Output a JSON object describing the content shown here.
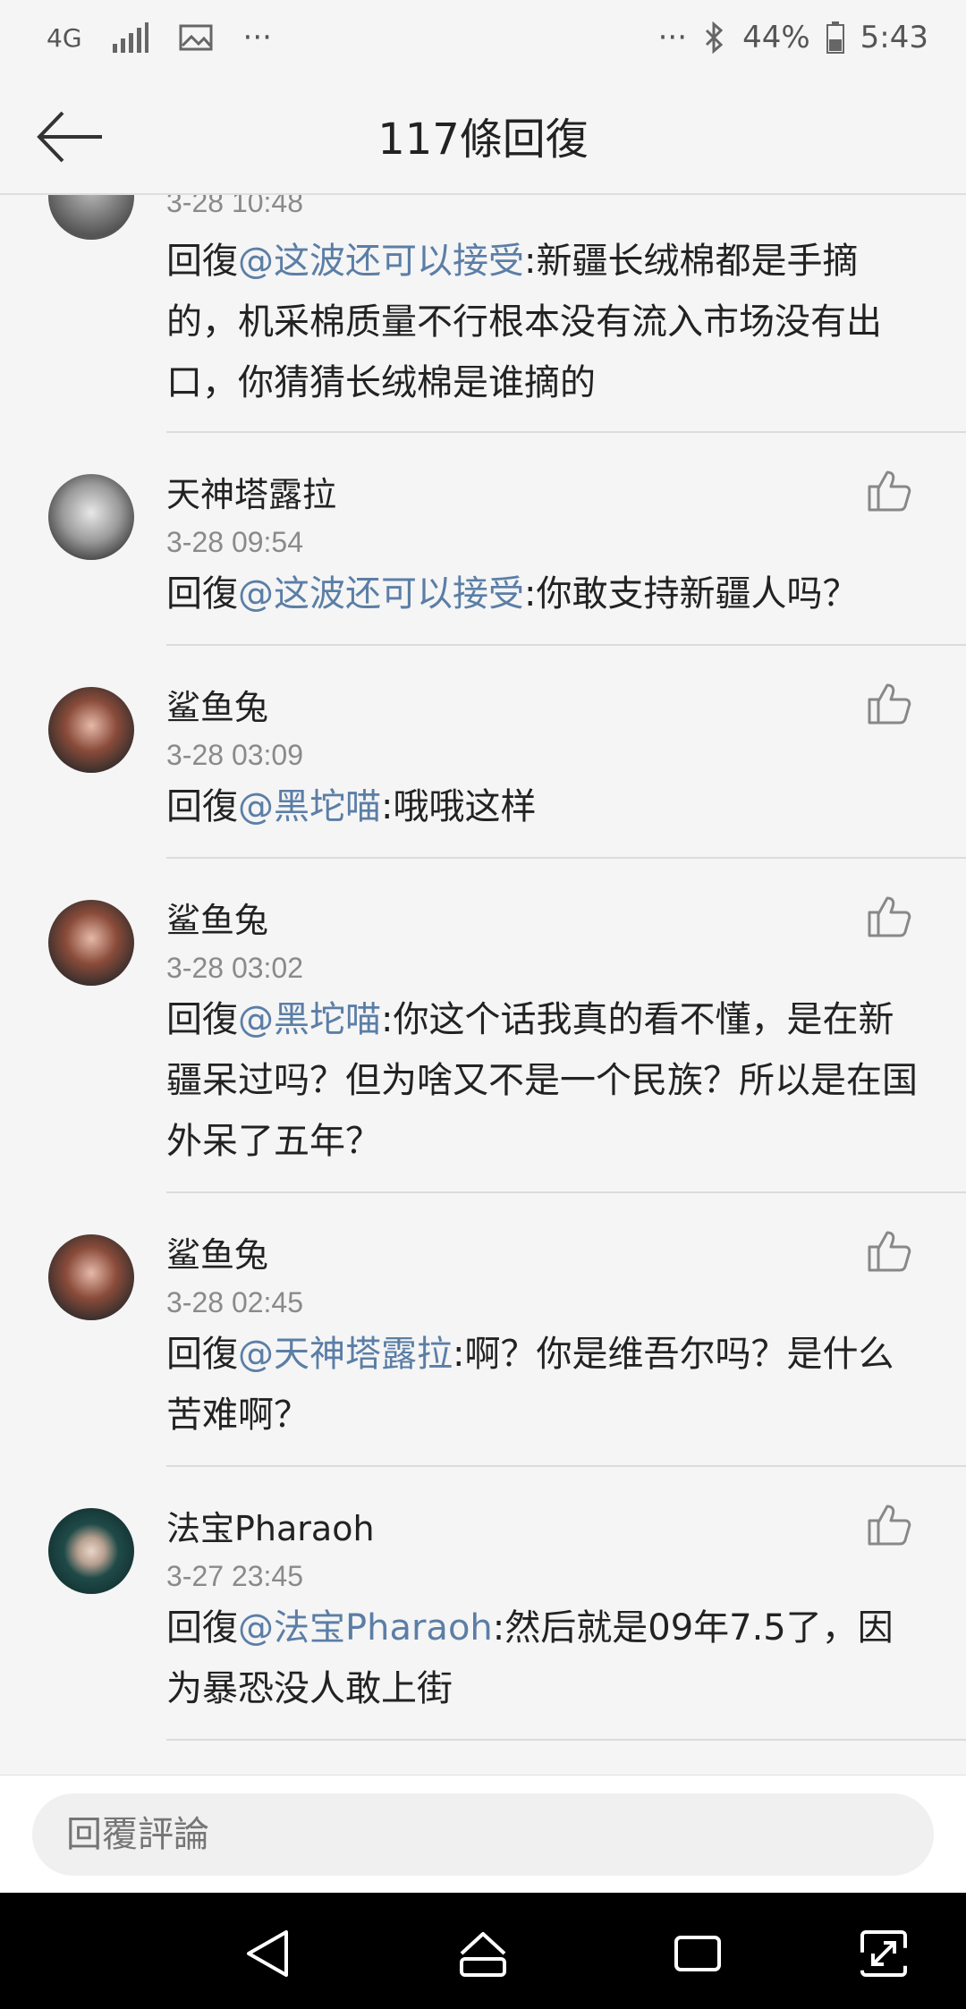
{
  "status_bar": {
    "network": "4G",
    "right_dots": "···",
    "left_dots": "···",
    "battery": "44%",
    "time": "5:43"
  },
  "header": {
    "title": "117條回復"
  },
  "comments": [
    {
      "username": "",
      "time": "3-28 10:48",
      "reply_prefix": "回復",
      "mention": "@这波还可以接受",
      "text": ":新疆长绒棉都是手摘的，机采棉质量不行根本没有流入市场没有出口，你猜猜长绒棉是谁摘的"
    },
    {
      "username": "天神塔露拉",
      "time": "3-28 09:54",
      "reply_prefix": "回復",
      "mention": "@这波还可以接受",
      "text": ":你敢支持新疆人吗？"
    },
    {
      "username": "鲨鱼兔",
      "time": "3-28 03:09",
      "reply_prefix": "回復",
      "mention": "@黑坨喵",
      "text": ":哦哦这样"
    },
    {
      "username": "鲨鱼兔",
      "time": "3-28 03:02",
      "reply_prefix": "回復",
      "mention": "@黑坨喵",
      "text": ":你这个话我真的看不懂，是在新疆呆过吗？但为啥又不是一个民族？所以是在国外呆了五年？"
    },
    {
      "username": "鲨鱼兔",
      "time": "3-28 02:45",
      "reply_prefix": "回復",
      "mention": "@天神塔露拉",
      "text": ":啊？你是维吾尔吗？是什么苦难啊？"
    },
    {
      "username": "法宝Pharaoh",
      "time": "3-27 23:45",
      "reply_prefix": "回復",
      "mention": "@法宝Pharaoh",
      "text": ":然后就是09年7.5了，因为暴恐没人敢上街"
    }
  ],
  "reply_input": {
    "placeholder": "回覆評論"
  },
  "colors": {
    "mention": "#5b7ea6",
    "background": "#f5f5f5",
    "navbar": "#000000"
  }
}
